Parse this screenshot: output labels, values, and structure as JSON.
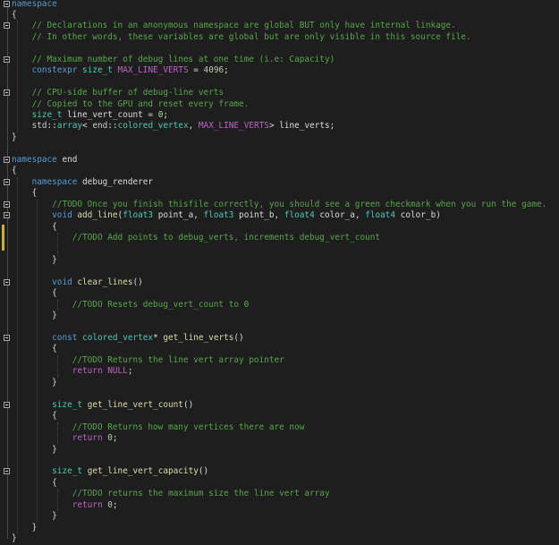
{
  "editor": {
    "lines": [
      {
        "fold": true,
        "tokens": [
          {
            "k": "kw",
            "t": "namespace"
          }
        ]
      },
      {
        "fold": false,
        "tokens": [
          {
            "k": "pl",
            "t": "{"
          }
        ]
      },
      {
        "fold": true,
        "tokens": [
          {
            "k": "pl",
            "t": "    "
          },
          {
            "k": "cm",
            "t": "// Declarations in an anonymous namespace are global BUT only have internal linkage."
          }
        ]
      },
      {
        "fold": false,
        "tokens": [
          {
            "k": "pl",
            "t": "    "
          },
          {
            "k": "cm",
            "t": "// In other words, these variables are global but are only visible in this source file."
          }
        ]
      },
      {
        "fold": false,
        "tokens": []
      },
      {
        "fold": true,
        "tokens": [
          {
            "k": "pl",
            "t": "    "
          },
          {
            "k": "cm",
            "t": "// Maximum number of debug lines at one time (i.e: Capacity)"
          }
        ]
      },
      {
        "fold": false,
        "tokens": [
          {
            "k": "pl",
            "t": "    "
          },
          {
            "k": "kw",
            "t": "constexpr"
          },
          {
            "k": "pl",
            "t": " "
          },
          {
            "k": "type",
            "t": "size_t"
          },
          {
            "k": "pl",
            "t": " "
          },
          {
            "k": "mac",
            "t": "MAX_LINE_VERTS"
          },
          {
            "k": "pl",
            "t": " = "
          },
          {
            "k": "num",
            "t": "4096"
          },
          {
            "k": "pl",
            "t": ";"
          }
        ]
      },
      {
        "fold": false,
        "tokens": []
      },
      {
        "fold": true,
        "tokens": [
          {
            "k": "pl",
            "t": "    "
          },
          {
            "k": "cm",
            "t": "// CPU-side buffer of debug-line verts"
          }
        ]
      },
      {
        "fold": false,
        "tokens": [
          {
            "k": "pl",
            "t": "    "
          },
          {
            "k": "cm",
            "t": "// Copied to the GPU and reset every frame."
          }
        ]
      },
      {
        "fold": false,
        "tokens": [
          {
            "k": "pl",
            "t": "    "
          },
          {
            "k": "type",
            "t": "size_t"
          },
          {
            "k": "pl",
            "t": " line_vert_count = "
          },
          {
            "k": "num",
            "t": "0"
          },
          {
            "k": "pl",
            "t": ";"
          }
        ]
      },
      {
        "fold": false,
        "tokens": [
          {
            "k": "pl",
            "t": "    "
          },
          {
            "k": "ns",
            "t": "std"
          },
          {
            "k": "pl",
            "t": "::"
          },
          {
            "k": "type",
            "t": "array"
          },
          {
            "k": "pl",
            "t": "< "
          },
          {
            "k": "ns",
            "t": "end"
          },
          {
            "k": "pl",
            "t": "::"
          },
          {
            "k": "type",
            "t": "colored_vertex"
          },
          {
            "k": "pl",
            "t": ", "
          },
          {
            "k": "mac",
            "t": "MAX_LINE_VERTS"
          },
          {
            "k": "pl",
            "t": "> line_verts;"
          }
        ]
      },
      {
        "fold": false,
        "tokens": [
          {
            "k": "pl",
            "t": "}"
          }
        ]
      },
      {
        "fold": false,
        "tokens": []
      },
      {
        "fold": true,
        "tokens": [
          {
            "k": "kw",
            "t": "namespace"
          },
          {
            "k": "pl",
            "t": " end"
          }
        ]
      },
      {
        "fold": false,
        "tokens": [
          {
            "k": "pl",
            "t": "{"
          }
        ]
      },
      {
        "fold": true,
        "tokens": [
          {
            "k": "pl",
            "t": "    "
          },
          {
            "k": "kw",
            "t": "namespace"
          },
          {
            "k": "pl",
            "t": " debug_renderer"
          }
        ]
      },
      {
        "fold": false,
        "tokens": [
          {
            "k": "pl",
            "t": "    {"
          }
        ]
      },
      {
        "fold": true,
        "tokens": [
          {
            "k": "pl",
            "t": "        "
          },
          {
            "k": "cm",
            "t": "//TODO Once you finish thisfile correctly, you should see a green checkmark when you run the game."
          }
        ]
      },
      {
        "fold": true,
        "tokens": [
          {
            "k": "pl",
            "t": "        "
          },
          {
            "k": "kw",
            "t": "void"
          },
          {
            "k": "pl",
            "t": " "
          },
          {
            "k": "fn",
            "t": "add_line"
          },
          {
            "k": "pl",
            "t": "("
          },
          {
            "k": "type",
            "t": "float3"
          },
          {
            "k": "pl",
            "t": " point_a, "
          },
          {
            "k": "type",
            "t": "float3"
          },
          {
            "k": "pl",
            "t": " point_b, "
          },
          {
            "k": "type",
            "t": "float4"
          },
          {
            "k": "pl",
            "t": " color_a, "
          },
          {
            "k": "type",
            "t": "float4"
          },
          {
            "k": "pl",
            "t": " color_b)"
          }
        ]
      },
      {
        "fold": false,
        "tokens": [
          {
            "k": "pl",
            "t": "        {"
          }
        ]
      },
      {
        "fold": false,
        "tokens": [
          {
            "k": "pl",
            "t": "            "
          },
          {
            "k": "cm",
            "t": "//TODO Add points to debug_verts, increments debug_vert_count"
          }
        ]
      },
      {
        "fold": false,
        "tokens": []
      },
      {
        "fold": false,
        "tokens": [
          {
            "k": "pl",
            "t": "        }"
          }
        ]
      },
      {
        "fold": false,
        "tokens": []
      },
      {
        "fold": true,
        "tokens": [
          {
            "k": "pl",
            "t": "        "
          },
          {
            "k": "kw",
            "t": "void"
          },
          {
            "k": "pl",
            "t": " "
          },
          {
            "k": "fn",
            "t": "clear_lines"
          },
          {
            "k": "pl",
            "t": "()"
          }
        ]
      },
      {
        "fold": false,
        "tokens": [
          {
            "k": "pl",
            "t": "        {"
          }
        ]
      },
      {
        "fold": false,
        "tokens": [
          {
            "k": "pl",
            "t": "            "
          },
          {
            "k": "cm",
            "t": "//TODO Resets debug_vert_count to 0"
          }
        ]
      },
      {
        "fold": false,
        "tokens": [
          {
            "k": "pl",
            "t": "        }"
          }
        ]
      },
      {
        "fold": false,
        "tokens": []
      },
      {
        "fold": true,
        "tokens": [
          {
            "k": "pl",
            "t": "        "
          },
          {
            "k": "kw",
            "t": "const"
          },
          {
            "k": "pl",
            "t": " "
          },
          {
            "k": "type",
            "t": "colored_vertex"
          },
          {
            "k": "pl",
            "t": "* "
          },
          {
            "k": "fn",
            "t": "get_line_verts"
          },
          {
            "k": "pl",
            "t": "()"
          }
        ]
      },
      {
        "fold": false,
        "tokens": [
          {
            "k": "pl",
            "t": "        {"
          }
        ]
      },
      {
        "fold": false,
        "tokens": [
          {
            "k": "pl",
            "t": "            "
          },
          {
            "k": "cm",
            "t": "//TODO Returns the line vert array pointer"
          }
        ]
      },
      {
        "fold": false,
        "tokens": [
          {
            "k": "pl",
            "t": "            "
          },
          {
            "k": "mac",
            "t": "return"
          },
          {
            "k": "pl",
            "t": " "
          },
          {
            "k": "mac",
            "t": "NULL"
          },
          {
            "k": "pl",
            "t": ";"
          }
        ]
      },
      {
        "fold": false,
        "tokens": [
          {
            "k": "pl",
            "t": "        }"
          }
        ]
      },
      {
        "fold": false,
        "tokens": []
      },
      {
        "fold": true,
        "tokens": [
          {
            "k": "pl",
            "t": "        "
          },
          {
            "k": "type",
            "t": "size_t"
          },
          {
            "k": "pl",
            "t": " "
          },
          {
            "k": "fn",
            "t": "get_line_vert_count"
          },
          {
            "k": "pl",
            "t": "()"
          }
        ]
      },
      {
        "fold": false,
        "tokens": [
          {
            "k": "pl",
            "t": "        {"
          }
        ]
      },
      {
        "fold": false,
        "tokens": [
          {
            "k": "pl",
            "t": "            "
          },
          {
            "k": "cm",
            "t": "//TODO Returns how many vertices there are now"
          }
        ]
      },
      {
        "fold": false,
        "tokens": [
          {
            "k": "pl",
            "t": "            "
          },
          {
            "k": "mac",
            "t": "return"
          },
          {
            "k": "pl",
            "t": " "
          },
          {
            "k": "num",
            "t": "0"
          },
          {
            "k": "pl",
            "t": ";"
          }
        ]
      },
      {
        "fold": false,
        "tokens": [
          {
            "k": "pl",
            "t": "        }"
          }
        ]
      },
      {
        "fold": false,
        "tokens": []
      },
      {
        "fold": true,
        "tokens": [
          {
            "k": "pl",
            "t": "        "
          },
          {
            "k": "type",
            "t": "size_t"
          },
          {
            "k": "pl",
            "t": " "
          },
          {
            "k": "fn",
            "t": "get_line_vert_capacity"
          },
          {
            "k": "pl",
            "t": "()"
          }
        ]
      },
      {
        "fold": false,
        "tokens": [
          {
            "k": "pl",
            "t": "        {"
          }
        ]
      },
      {
        "fold": false,
        "tokens": [
          {
            "k": "pl",
            "t": "            "
          },
          {
            "k": "cm",
            "t": "//TODO returns the maximum size the line vert array"
          }
        ]
      },
      {
        "fold": false,
        "tokens": [
          {
            "k": "pl",
            "t": "            "
          },
          {
            "k": "mac",
            "t": "return"
          },
          {
            "k": "pl",
            "t": " "
          },
          {
            "k": "num",
            "t": "0"
          },
          {
            "k": "pl",
            "t": ";"
          }
        ]
      },
      {
        "fold": false,
        "tokens": [
          {
            "k": "pl",
            "t": "        }"
          }
        ]
      },
      {
        "fold": false,
        "tokens": [
          {
            "k": "pl",
            "t": "    }"
          }
        ]
      },
      {
        "fold": false,
        "tokens": [
          {
            "k": "pl",
            "t": "}"
          }
        ]
      }
    ],
    "changed_line_index": 21,
    "colors": {
      "background": "#1e1e1e",
      "keyword": "#569cd6",
      "type": "#4ec9b0",
      "comment": "#57a64a",
      "number": "#b5cea8",
      "macro": "#bd63c5",
      "function": "#dcdcaa",
      "text": "#dcdcdc",
      "change_marker": "#c7b33c"
    }
  }
}
